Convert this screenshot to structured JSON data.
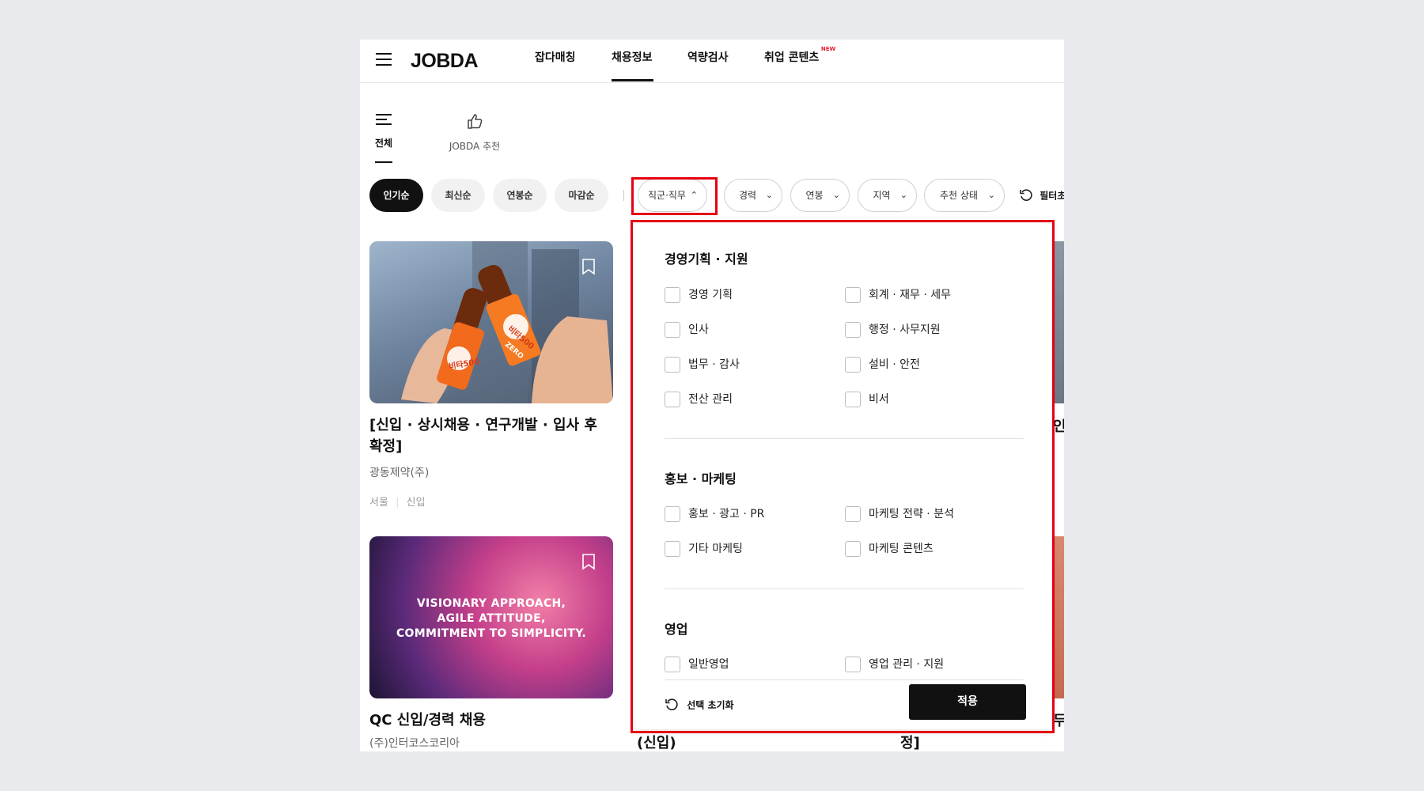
{
  "header": {
    "logo": "JOBDA",
    "nav": [
      "잡다매칭",
      "채용정보",
      "역량검사",
      "취업 콘텐츠"
    ],
    "new_badge": "NEW"
  },
  "categories": [
    "전체",
    "JOBDA 추천"
  ],
  "sort_options": [
    "인기순",
    "최신순",
    "연봉순",
    "마감순"
  ],
  "filters": [
    "직군·직무",
    "경력",
    "연봉",
    "지역",
    "추천 상태"
  ],
  "filter_reset": "필터초",
  "jobs": [
    {
      "title": "[신입 · 상시채용 · 연구개발 · 입사 후 확정]",
      "company": "광동제약(주)",
      "location": "서울",
      "career": "신입",
      "image_text": [
        "비타500",
        "ZERO"
      ]
    },
    {
      "title": "QC 신입/경력 채용",
      "company": "(주)인터코스코리아",
      "image_text": [
        "VISIONARY APPROACH,",
        "AGILE ATTITUDE,",
        "COMMITMENT TO SIMPLICITY."
      ]
    }
  ],
  "partial_text": {
    "col2_bottom": "(신입)",
    "col3_bottom": "정]",
    "col3_mid": "인",
    "col3_lower": "두"
  },
  "dropdown": {
    "groups": [
      {
        "title": "경영기획 · 지원",
        "options": [
          "경영 기획",
          "회계 · 재무 · 세무",
          "인사",
          "행정 · 사무지원",
          "법무 · 감사",
          "설비 · 안전",
          "전산 관리",
          "비서"
        ]
      },
      {
        "title": "홍보 · 마케팅",
        "options": [
          "홍보 · 광고 · PR",
          "마케팅 전략 · 분석",
          "기타 마케팅",
          "마케팅 콘텐츠"
        ]
      },
      {
        "title": "영업",
        "options": [
          "일반영업",
          "영업 관리 · 지원"
        ]
      }
    ],
    "reset_label": "선택 초기화",
    "apply_label": "적용"
  },
  "colors": {
    "accent": "#e60012",
    "black": "#111111"
  }
}
